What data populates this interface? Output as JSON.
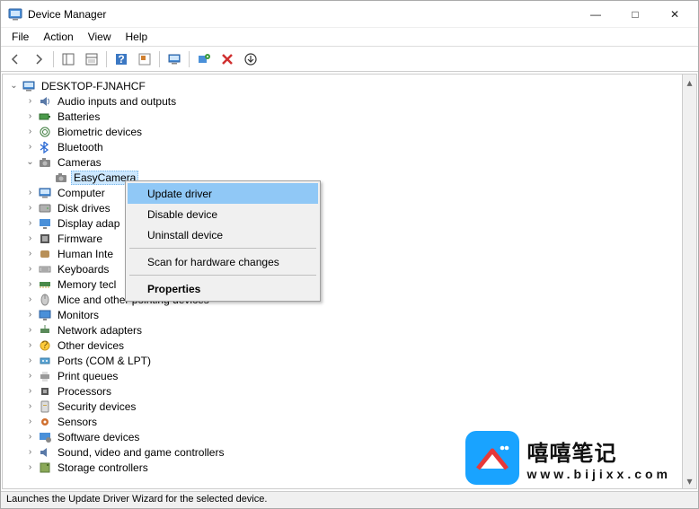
{
  "window": {
    "title": "Device Manager",
    "minimize_glyph": "—",
    "maximize_glyph": "□",
    "close_glyph": "✕"
  },
  "menubar": [
    "File",
    "Action",
    "View",
    "Help"
  ],
  "toolbar_buttons": [
    {
      "name": "back"
    },
    {
      "name": "forward"
    },
    {
      "sep": true
    },
    {
      "name": "show-hide-tree"
    },
    {
      "name": "properties-sheet"
    },
    {
      "sep": true
    },
    {
      "name": "help"
    },
    {
      "name": "action-pane"
    },
    {
      "sep": true
    },
    {
      "name": "computer-icon"
    },
    {
      "sep": true
    },
    {
      "name": "scan-hardware"
    },
    {
      "name": "uninstall-red"
    },
    {
      "name": "update-driver-icon"
    }
  ],
  "tree": {
    "root": {
      "label": "DESKTOP-FJNAHCF",
      "expanded": true,
      "icon": "computer"
    },
    "items": [
      {
        "label": "Audio inputs and outputs",
        "icon": "audio",
        "exp": ">"
      },
      {
        "label": "Batteries",
        "icon": "battery",
        "exp": ">"
      },
      {
        "label": "Biometric devices",
        "icon": "biometric",
        "exp": ">"
      },
      {
        "label": "Bluetooth",
        "icon": "bluetooth",
        "exp": ">"
      },
      {
        "label": "Cameras",
        "icon": "camera",
        "exp": "v",
        "expanded": true,
        "children": [
          {
            "label": "EasyCamera",
            "icon": "camera",
            "selected": true
          }
        ]
      },
      {
        "label": "Computer",
        "icon": "computer",
        "exp": ">"
      },
      {
        "label": "Disk drives",
        "icon": "disk",
        "exp": ">"
      },
      {
        "label": "Display adapters",
        "icon": "display",
        "exp": ">",
        "truncated": true
      },
      {
        "label": "Firmware",
        "icon": "firmware",
        "exp": ">"
      },
      {
        "label": "Human Interface Devices",
        "icon": "hid",
        "exp": ">",
        "truncated": true
      },
      {
        "label": "Keyboards",
        "icon": "keyboard",
        "exp": ">"
      },
      {
        "label": "Memory technology devices",
        "icon": "memory",
        "exp": ">",
        "truncated": true
      },
      {
        "label": "Mice and other pointing devices",
        "icon": "mouse",
        "exp": ">"
      },
      {
        "label": "Monitors",
        "icon": "monitor",
        "exp": ">"
      },
      {
        "label": "Network adapters",
        "icon": "network",
        "exp": ">"
      },
      {
        "label": "Other devices",
        "icon": "other",
        "exp": ">"
      },
      {
        "label": "Ports (COM & LPT)",
        "icon": "port",
        "exp": ">"
      },
      {
        "label": "Print queues",
        "icon": "printer",
        "exp": ">"
      },
      {
        "label": "Processors",
        "icon": "cpu",
        "exp": ">"
      },
      {
        "label": "Security devices",
        "icon": "security",
        "exp": ">"
      },
      {
        "label": "Sensors",
        "icon": "sensor",
        "exp": ">"
      },
      {
        "label": "Software devices",
        "icon": "software",
        "exp": ">"
      },
      {
        "label": "Sound, video and game controllers",
        "icon": "sound",
        "exp": ">"
      },
      {
        "label": "Storage controllers",
        "icon": "storage",
        "exp": ">",
        "cutoff": true
      }
    ]
  },
  "context_menu": {
    "items": [
      {
        "label": "Update driver",
        "highlight": true
      },
      {
        "label": "Disable device"
      },
      {
        "label": "Uninstall device"
      },
      {
        "sep": true
      },
      {
        "label": "Scan for hardware changes"
      },
      {
        "sep": true
      },
      {
        "label": "Properties",
        "bold": true
      }
    ]
  },
  "statusbar": "Launches the Update Driver Wizard for the selected device.",
  "watermark": {
    "cn": "嘻嘻笔记",
    "url": "www.bijixx.com"
  },
  "truncated_labels": {
    "Display adapters": "Display adap",
    "Human Interface Devices": "Human Inte",
    "Memory technology devices": "Memory tecl",
    "Storage controllers": "Storage controllers"
  }
}
